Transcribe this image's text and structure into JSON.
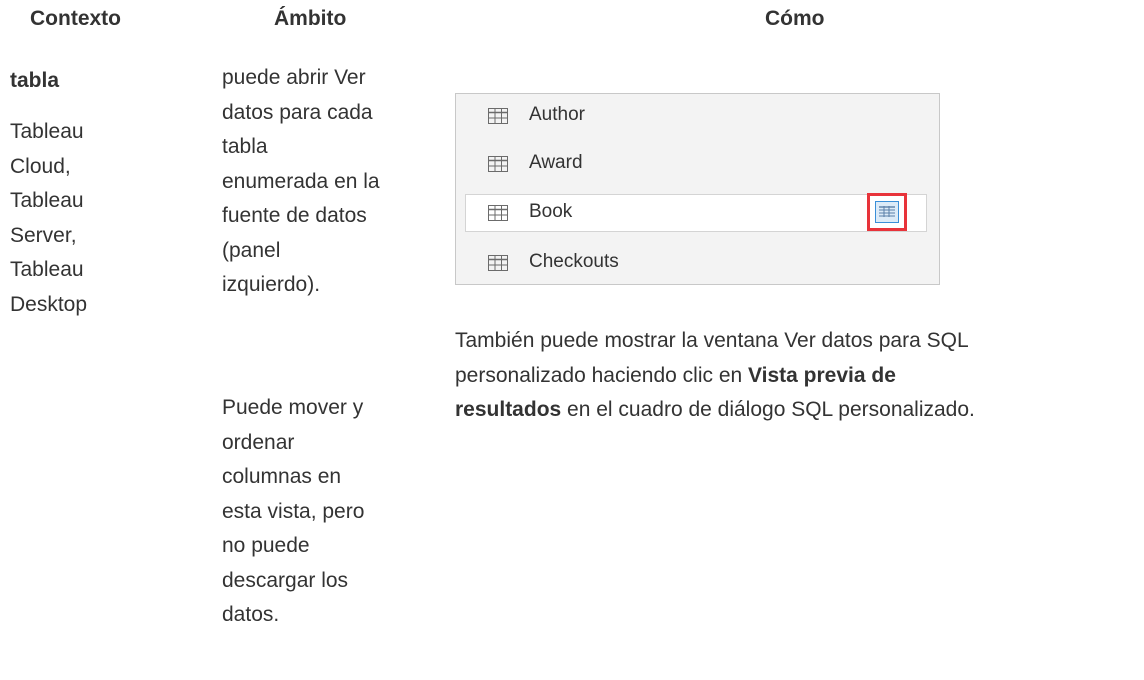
{
  "headers": {
    "contexto": "Contexto",
    "ambito": "Ámbito",
    "como": "Cómo"
  },
  "contexto": {
    "title": "tabla",
    "lines": [
      "Tableau",
      "Cloud,",
      "Tableau",
      "Server,",
      "Tableau",
      "Desktop"
    ]
  },
  "ambito": {
    "para1": [
      "puede abrir Ver",
      "datos para cada",
      "tabla",
      "enumerada en la",
      "fuente de datos",
      "(panel",
      "izquierdo)."
    ],
    "para2": [
      "Puede mover y",
      "ordenar",
      "columnas en",
      "esta vista, pero",
      "no puede",
      "descargar los",
      "datos."
    ]
  },
  "panel": {
    "items": [
      {
        "label": "Author",
        "icon": "table-icon"
      },
      {
        "label": "Award",
        "icon": "table-icon"
      },
      {
        "label": "Book",
        "icon": "table-icon",
        "selected": true,
        "action_icon": "view-data-icon"
      },
      {
        "label": "Checkouts",
        "icon": "table-icon"
      }
    ],
    "highlight_color": "#e8333a"
  },
  "como": {
    "lines": [
      [
        "También puede mostrar la ventana Ver datos para SQL"
      ],
      [
        "personalizado haciendo clic en ",
        "Vista previa de"
      ],
      [
        "resultados",
        " en el cuadro de diálogo SQL personalizado."
      ]
    ]
  }
}
